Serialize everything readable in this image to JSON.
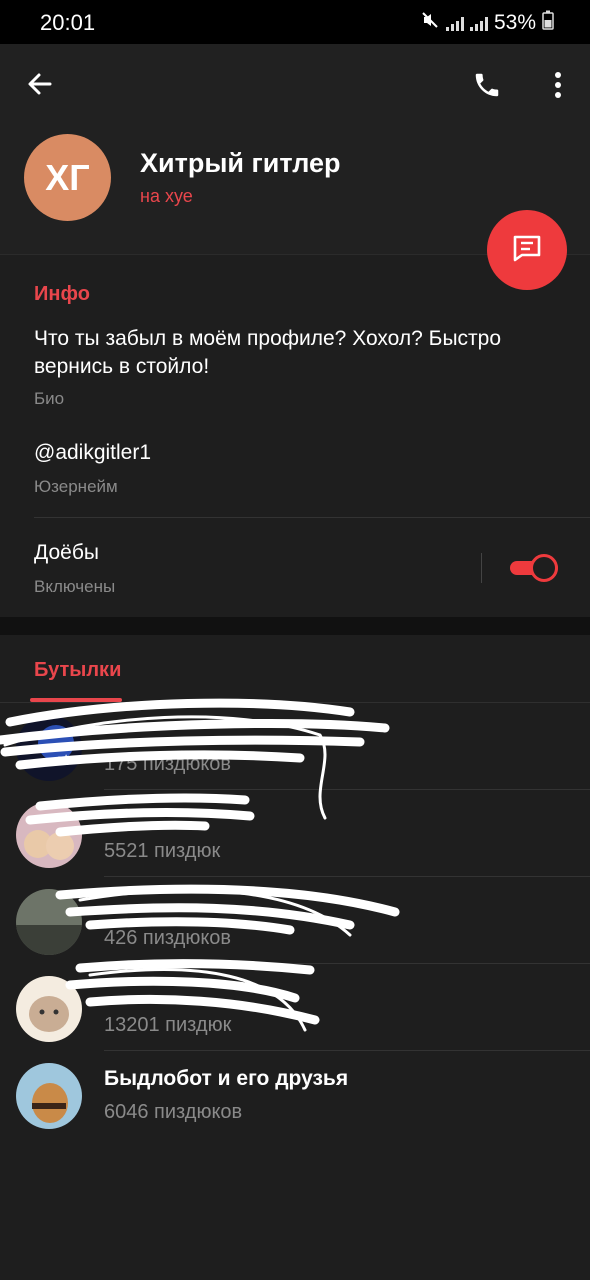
{
  "statusbar": {
    "time": "20:01",
    "battery": "53%"
  },
  "header": {
    "avatar_initials": "ХГ",
    "name": "Хитрый гитлер",
    "status": "на хуе"
  },
  "info": {
    "section_title": "Инфо",
    "bio": "Что ты забыл в моём профиле? Хохол? Быстро вернись в стойло!",
    "bio_label": "Био",
    "username": "@adikgitler1",
    "username_label": "Юзернейм",
    "notifications_title": "Доёбы",
    "notifications_state": "Включены",
    "notifications_on": true
  },
  "groups": {
    "tab_label": "Бутылки",
    "items": [
      {
        "title": "",
        "count": "175 пиздюков"
      },
      {
        "title": "",
        "count": "5521 пиздюк"
      },
      {
        "title": "",
        "count": "426 пиздюков"
      },
      {
        "title": "",
        "count": "13201 пиздюк"
      },
      {
        "title": "Быдлобот и его друзья",
        "count": "6046 пиздюков"
      }
    ]
  },
  "colors": {
    "accent": "#e9464c",
    "fab": "#ee3a3d",
    "avatar": "#d98b63"
  },
  "icons": [
    "back-arrow-icon",
    "phone-icon",
    "more-vert-icon",
    "message-icon"
  ]
}
